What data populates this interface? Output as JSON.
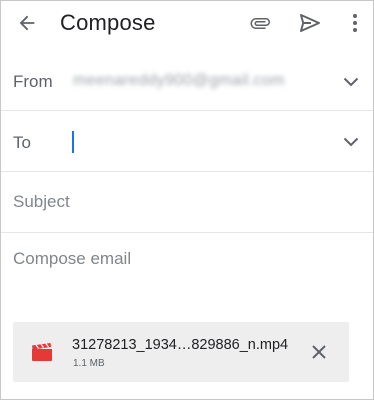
{
  "appbar": {
    "title": "Compose",
    "icons": {
      "back": "arrow-back-icon",
      "attach": "paperclip-icon",
      "send": "send-icon",
      "more": "more-vert-icon"
    }
  },
  "from": {
    "label": "From",
    "value": "meenareddy900@gmail.com"
  },
  "to": {
    "label": "To",
    "value": ""
  },
  "subject": {
    "placeholder": "Subject"
  },
  "body": {
    "placeholder": "Compose email"
  },
  "attachment": {
    "filename": "31278213_1934…829886_n.mp4",
    "size": "1.1 MB",
    "icon": "video-file-icon",
    "icon_color": "#e53935"
  },
  "colors": {
    "accent": "#1a73e8",
    "text_secondary": "#5f6368",
    "chip_bg": "#eeeeef"
  }
}
